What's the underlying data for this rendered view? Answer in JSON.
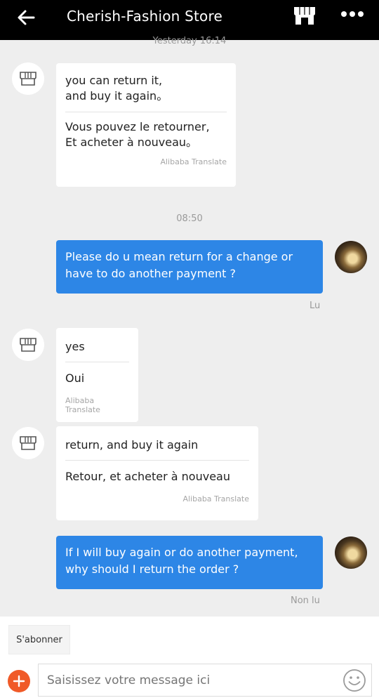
{
  "header": {
    "title": "Cherish-Fashion Store",
    "back_icon": "back-arrow-icon",
    "store_icon": "store-icon",
    "more_icon": "more-icon"
  },
  "timestamps": {
    "first": "Yesterday 16:14",
    "second": "08:50"
  },
  "messages": [
    {
      "from": "store",
      "original": "you can return it,\nand buy it again。",
      "translation": "Vous pouvez le retourner,\nEt acheter à nouveau。",
      "credit": "Alibaba Translate"
    },
    {
      "from": "user",
      "text": "Please do u mean return for a change or have to do another payment ?",
      "status": "Lu"
    },
    {
      "from": "store",
      "original": "yes",
      "translation": "Oui",
      "credit": "Alibaba Translate"
    },
    {
      "from": "store",
      "original": "return, and buy it again",
      "translation": "Retour, et acheter à nouveau",
      "credit": "Alibaba Translate"
    },
    {
      "from": "user",
      "text": "If I will buy again or do another payment, why should I return the order ?",
      "status": "Non lu"
    }
  ],
  "composer": {
    "subscribe_label": "S'abonner",
    "placeholder": "Saisissez votre message ici",
    "add_icon": "plus-icon",
    "emoji_icon": "emoji-icon"
  },
  "colors": {
    "header_bg": "#000000",
    "outgoing_bubble": "#2d86e6",
    "add_button": "#f05a28",
    "chat_bg": "#eeeeee"
  }
}
